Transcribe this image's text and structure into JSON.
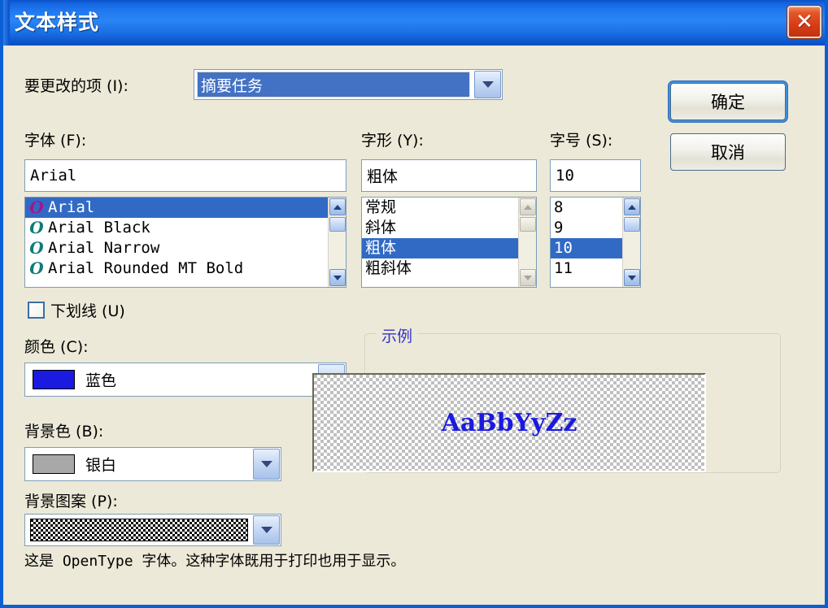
{
  "window": {
    "title": "文本样式",
    "close_icon": "close-x-icon"
  },
  "item_to_change": {
    "label": "要更改的项 (I):",
    "value": "摘要任务"
  },
  "font": {
    "label": "字体 (F):",
    "value": "Arial",
    "items": [
      {
        "name": "Arial",
        "selected": true
      },
      {
        "name": "Arial Black",
        "selected": false
      },
      {
        "name": "Arial Narrow",
        "selected": false
      },
      {
        "name": "Arial Rounded MT Bold",
        "selected": false
      }
    ],
    "opentype_glyph": "O"
  },
  "style": {
    "label": "字形 (Y):",
    "value": "粗体",
    "items": [
      {
        "name": "常规",
        "selected": false
      },
      {
        "name": "斜体",
        "selected": false
      },
      {
        "name": "粗体",
        "selected": true
      },
      {
        "name": "粗斜体",
        "selected": false
      }
    ]
  },
  "size": {
    "label": "字号 (S):",
    "value": "10",
    "items": [
      {
        "name": "8",
        "selected": false
      },
      {
        "name": "9",
        "selected": false
      },
      {
        "name": "10",
        "selected": true
      },
      {
        "name": "11",
        "selected": false
      }
    ]
  },
  "underline": {
    "label": "下划线 (U)",
    "checked": false
  },
  "color": {
    "label": "颜色 (C):",
    "value": "蓝色",
    "swatch_hex": "#1a1ae0"
  },
  "background_color": {
    "label": "背景色 (B):",
    "value": "银白",
    "swatch_hex": "#a8a8a8"
  },
  "background_pattern": {
    "label": "背景图案 (P):",
    "value": "dense-dot-pattern"
  },
  "sample": {
    "group_title": "示例",
    "text": "AaBbYyZz",
    "text_color_hex": "#1a1ae0",
    "panel_bg_hex": "#bfbfbf"
  },
  "description": "这是 OpenType 字体。这种字体既用于打印也用于显示。",
  "buttons": {
    "ok": "确定",
    "cancel": "取消"
  },
  "scrollbars": {
    "up_arrow_icon": "scroll-up-arrow-icon",
    "down_arrow_icon": "scroll-down-arrow-icon"
  }
}
